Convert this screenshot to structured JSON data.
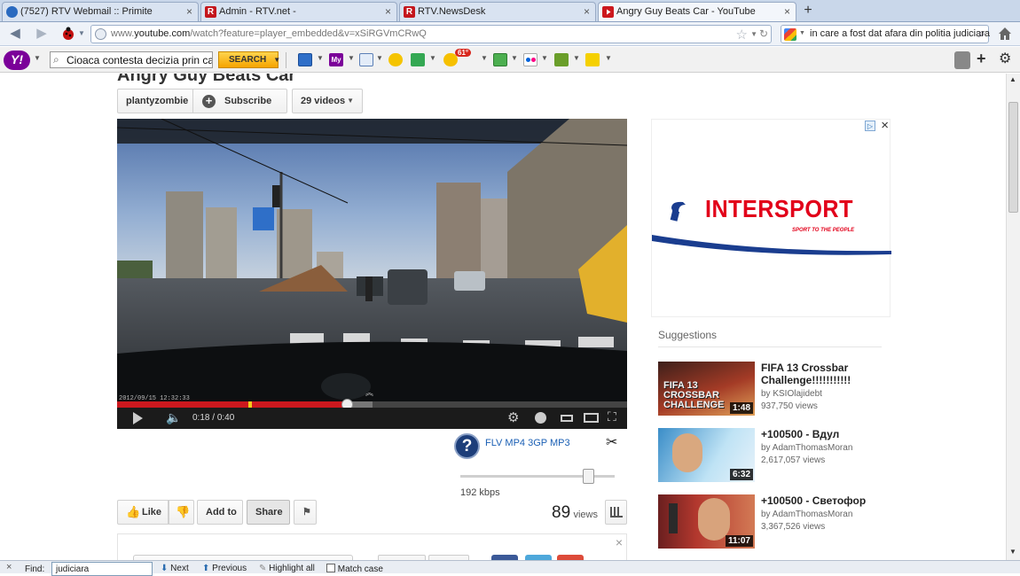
{
  "browser": {
    "tabs": [
      {
        "title": "(7527) RTV Webmail :: Primite"
      },
      {
        "title": "Admin - RTV.net -"
      },
      {
        "title": "RTV.NewsDesk"
      },
      {
        "title": "Angry Guy Beats Car - YouTube"
      }
    ],
    "new_tab_label": "+",
    "url_prefix": "www.",
    "url_domain": "youtube.com",
    "url_rest": "/watch?feature=player_embedded&v=xSiRGVmCRwQ",
    "search_query": "in care a fost dat afara din politia judiciara"
  },
  "yahoo_toolbar": {
    "search_value": "Cioaca contesta decizia prin care",
    "search_button": "SEARCH",
    "weather_badge": "61°"
  },
  "video": {
    "title": "Angry Guy Beats Car",
    "channel": "plantyzombie",
    "subscribe": "Subscribe",
    "videos_count": "29 videos",
    "time_current": "0:18",
    "time_total": "0:40",
    "timestamp_overlay": "2012/09/15  12:32:33",
    "progress_fraction": 0.45,
    "buffered_fraction": 0.5,
    "views": "89",
    "views_label": "views",
    "like": "Like",
    "add_to": "Add to",
    "share": "Share"
  },
  "downloader": {
    "formats": "FLV MP4 3GP MP3",
    "bitrate": "192 kbps",
    "question": "?"
  },
  "ad": {
    "brand": "INTERSPORT",
    "tagline": "SPORT TO THE PEOPLE"
  },
  "suggestions": {
    "title": "Suggestions",
    "items": [
      {
        "title": "FIFA 13 Crossbar Challenge!!!!!!!!!!!",
        "by": "by KSIOlajidebt",
        "views": "937,750 views",
        "duration": "1:48",
        "thumb_text": "FIFA 13 CROSSBAR CHALLENGE"
      },
      {
        "title": "+100500 - Вдул",
        "by": "by AdamThomasMoran",
        "views": "2,617,057 views",
        "duration": "6:32"
      },
      {
        "title": "+100500 - Светофор",
        "by": "by AdamThomasMoran",
        "views": "3,367,526 views",
        "duration": "11:07"
      }
    ]
  },
  "findbar": {
    "label": "Find:",
    "value": "judiciara",
    "next": "Next",
    "previous": "Previous",
    "highlight": "Highlight all",
    "match_case": "Match case"
  },
  "colors": {
    "accent_red": "#cc181e",
    "yahoo_purple": "#7b0099",
    "intersport_red": "#e2001a",
    "intersport_blue": "#1a3d8f"
  }
}
